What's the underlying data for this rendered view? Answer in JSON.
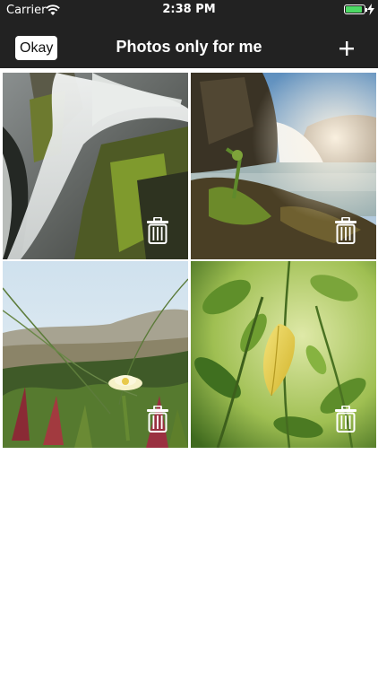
{
  "status_bar": {
    "carrier": "Carrier",
    "time": "2:38 PM",
    "battery_level": 0.9,
    "icons": [
      "wifi-icon",
      "battery-icon",
      "charging-bolt-icon"
    ]
  },
  "nav": {
    "left_button_label": "Okay",
    "title": "Photos only for me",
    "right_button_icon": "plus-icon"
  },
  "photos": [
    {
      "subject": "waterfall over mossy rocks",
      "delete_icon": "trash-icon"
    },
    {
      "subject": "waterfall at a lake shore",
      "delete_icon": "trash-icon"
    },
    {
      "subject": "beach grass with yellow flower",
      "delete_icon": "trash-icon"
    },
    {
      "subject": "green leaves with yellow leaf",
      "delete_icon": "trash-icon"
    }
  ],
  "colors": {
    "bars": "#222222",
    "battery_green": "#4cd964",
    "background": "#ffffff"
  }
}
